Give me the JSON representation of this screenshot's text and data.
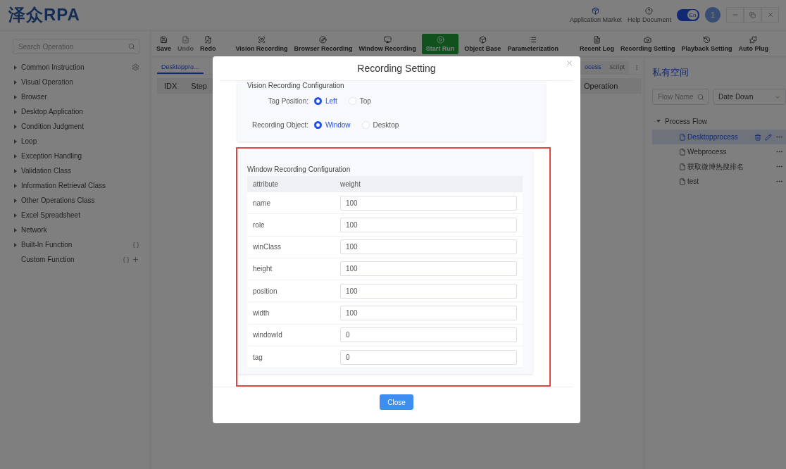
{
  "app": {
    "logo": "泽众RPA"
  },
  "header": {
    "links": [
      {
        "label": "Application Market",
        "kind": "market"
      },
      {
        "label": "Help Document",
        "kind": "help"
      }
    ],
    "language_toggle": {
      "label": "En",
      "on": true
    },
    "avatar": "1"
  },
  "sidebar": {
    "search": {
      "placeholder": "Search Operation"
    },
    "items": [
      {
        "label": "Common Instruction",
        "kind": "settings"
      },
      {
        "label": "Visual Operation",
        "kind": "category"
      },
      {
        "label": "Browser",
        "kind": "category"
      },
      {
        "label": "Desktop Application",
        "kind": "category"
      },
      {
        "label": "Condition Judgment",
        "kind": "category"
      },
      {
        "label": "Loop",
        "kind": "category"
      },
      {
        "label": "Exception Handling",
        "kind": "category"
      },
      {
        "label": "Validation Class",
        "kind": "category"
      },
      {
        "label": "Information Retrieval Class",
        "kind": "category"
      },
      {
        "label": "Other Operations Class",
        "kind": "category"
      },
      {
        "label": "Excel Spreadsheet",
        "kind": "category"
      },
      {
        "label": "Network",
        "kind": "category"
      },
      {
        "label": "Built-In Function",
        "kind": "builtin"
      },
      {
        "label": "Custom Function",
        "kind": "custom"
      }
    ]
  },
  "toolbar": [
    {
      "label": "Save",
      "kind": "save",
      "disabled": false,
      "highlighted": false
    },
    {
      "label": "Undo",
      "kind": "undo",
      "disabled": true,
      "highlighted": false
    },
    {
      "label": "Redo",
      "kind": "redo",
      "disabled": false,
      "highlighted": false
    },
    {
      "label": "Vision Recording",
      "kind": "vision",
      "disabled": false,
      "highlighted": false
    },
    {
      "label": "Browser Recording",
      "kind": "browser",
      "disabled": false,
      "highlighted": false
    },
    {
      "label": "Window Recording",
      "kind": "window",
      "disabled": false,
      "highlighted": false
    },
    {
      "label": "Start Run",
      "kind": "run",
      "disabled": false,
      "highlighted": true
    },
    {
      "label": "Object Base",
      "kind": "object",
      "disabled": false,
      "highlighted": false
    },
    {
      "label": "Parameterization",
      "kind": "params",
      "disabled": false,
      "highlighted": false
    },
    {
      "label": "Recent Log",
      "kind": "log",
      "disabled": false,
      "highlighted": false
    },
    {
      "label": "Recording Setting",
      "kind": "recsetting",
      "disabled": false,
      "highlighted": false
    },
    {
      "label": "Playback Setting",
      "kind": "playback",
      "disabled": false,
      "highlighted": false
    },
    {
      "label": "Auto Plug",
      "kind": "plug",
      "disabled": false,
      "highlighted": false
    }
  ],
  "editor": {
    "tabs": [
      {
        "label": "Desktoppro...",
        "selected": true
      }
    ],
    "side_tabs": [
      {
        "label": "ocess",
        "selected": true
      },
      {
        "label": "script",
        "selected": false
      }
    ],
    "columns": [
      "IDX",
      "Step"
    ],
    "operation_column": "Operation"
  },
  "flows": {
    "title": "私有空间",
    "search": {
      "placeholder": "Flow Name"
    },
    "sort": {
      "value": "Date Down"
    },
    "tree": [
      {
        "label": "Process Flow",
        "expanded": true,
        "children": [
          {
            "label": "Desktopprocess",
            "selected": true
          },
          {
            "label": "Webprocess",
            "selected": false
          },
          {
            "label": "获取微博热搜排名",
            "selected": false
          },
          {
            "label": "test",
            "selected": false
          }
        ]
      }
    ]
  },
  "dialog": {
    "title": "Recording Setting",
    "vision": {
      "title": "Vision Recording Configuration",
      "groups": [
        {
          "label": "Tag Position:",
          "options": [
            {
              "label": "Left",
              "selected": true
            },
            {
              "label": "Top",
              "selected": false
            }
          ]
        },
        {
          "label": "Recording Object:",
          "options": [
            {
              "label": "Window",
              "selected": true
            },
            {
              "label": "Desktop",
              "selected": false
            }
          ]
        }
      ]
    },
    "window": {
      "title": "Window Recording Configuration",
      "highlighted": true,
      "columns": [
        "attribute",
        "weight"
      ],
      "rows": [
        {
          "attribute": "name",
          "value": "100"
        },
        {
          "attribute": "role",
          "value": "100"
        },
        {
          "attribute": "winClass",
          "value": "100"
        },
        {
          "attribute": "height",
          "value": "100"
        },
        {
          "attribute": "position",
          "value": "100"
        },
        {
          "attribute": "width",
          "value": "100"
        },
        {
          "attribute": "windowId",
          "value": "0"
        },
        {
          "attribute": "tag",
          "value": "0"
        }
      ]
    },
    "close_button": "Close"
  }
}
